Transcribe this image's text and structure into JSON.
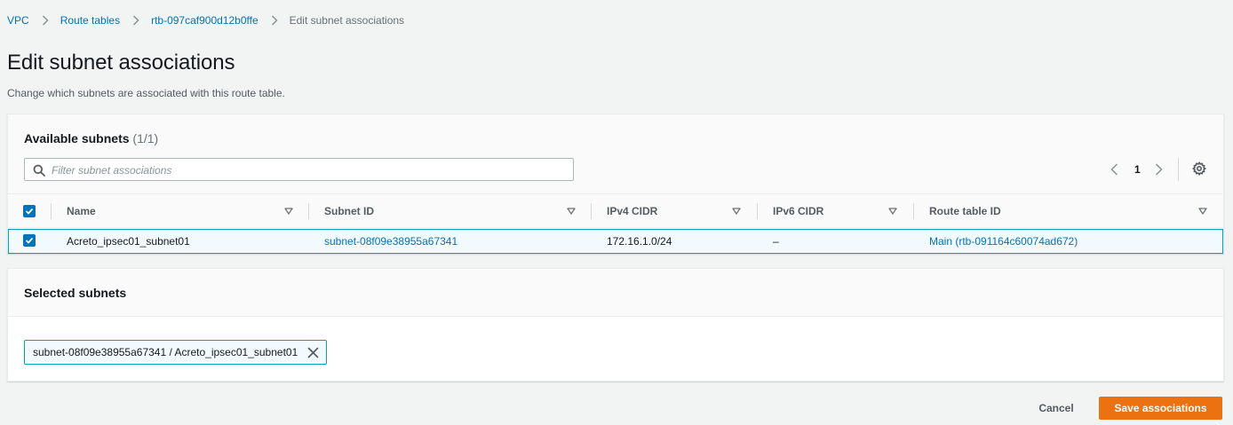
{
  "breadcrumb": {
    "items": [
      {
        "label": "VPC"
      },
      {
        "label": "Route tables"
      },
      {
        "label": "rtb-097caf900d12b0ffe"
      }
    ],
    "current": "Edit subnet associations"
  },
  "page": {
    "title": "Edit subnet associations",
    "description": "Change which subnets are associated with this route table."
  },
  "available": {
    "title": "Available subnets",
    "count": "(1/1)",
    "search_placeholder": "Filter subnet associations",
    "search_value": "",
    "page_number": "1",
    "columns": [
      "Name",
      "Subnet ID",
      "IPv4 CIDR",
      "IPv6 CIDR",
      "Route table ID"
    ],
    "rows": [
      {
        "selected": true,
        "name": "Acreto_ipsec01_subnet01",
        "subnet_id": "subnet-08f09e38955a67341",
        "ipv4_cidr": "172.16.1.0/24",
        "ipv6_cidr": "–",
        "route_table_id": "Main (rtb-091164c60074ad672)"
      }
    ]
  },
  "selected": {
    "title": "Selected subnets",
    "tokens": [
      {
        "label": "subnet-08f09e38955a67341 / Acreto_ipsec01_subnet01"
      }
    ]
  },
  "footer": {
    "cancel_label": "Cancel",
    "save_label": "Save associations"
  },
  "colors": {
    "link": "#0073bb",
    "primary_button": "#ec7211",
    "selection_border": "#00a1c9",
    "selection_bg": "#f1faff",
    "page_bg": "#f2f3f3"
  },
  "icons": {
    "search": "search-icon",
    "settings": "gear-icon",
    "sort": "sort-caret-icon",
    "remove": "close-icon",
    "breadcrumb_separator": "chevron-right-icon"
  }
}
